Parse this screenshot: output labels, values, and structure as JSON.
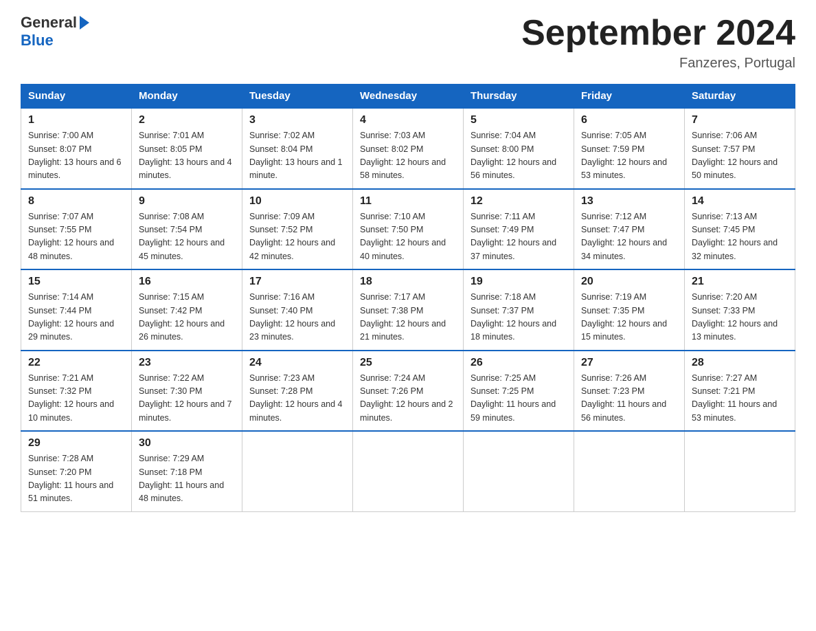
{
  "logo": {
    "general": "General",
    "blue": "Blue"
  },
  "title": "September 2024",
  "subtitle": "Fanzeres, Portugal",
  "days_of_week": [
    "Sunday",
    "Monday",
    "Tuesday",
    "Wednesday",
    "Thursday",
    "Friday",
    "Saturday"
  ],
  "weeks": [
    [
      {
        "day": "1",
        "sunrise": "7:00 AM",
        "sunset": "8:07 PM",
        "daylight": "13 hours and 6 minutes."
      },
      {
        "day": "2",
        "sunrise": "7:01 AM",
        "sunset": "8:05 PM",
        "daylight": "13 hours and 4 minutes."
      },
      {
        "day": "3",
        "sunrise": "7:02 AM",
        "sunset": "8:04 PM",
        "daylight": "13 hours and 1 minute."
      },
      {
        "day": "4",
        "sunrise": "7:03 AM",
        "sunset": "8:02 PM",
        "daylight": "12 hours and 58 minutes."
      },
      {
        "day": "5",
        "sunrise": "7:04 AM",
        "sunset": "8:00 PM",
        "daylight": "12 hours and 56 minutes."
      },
      {
        "day": "6",
        "sunrise": "7:05 AM",
        "sunset": "7:59 PM",
        "daylight": "12 hours and 53 minutes."
      },
      {
        "day": "7",
        "sunrise": "7:06 AM",
        "sunset": "7:57 PM",
        "daylight": "12 hours and 50 minutes."
      }
    ],
    [
      {
        "day": "8",
        "sunrise": "7:07 AM",
        "sunset": "7:55 PM",
        "daylight": "12 hours and 48 minutes."
      },
      {
        "day": "9",
        "sunrise": "7:08 AM",
        "sunset": "7:54 PM",
        "daylight": "12 hours and 45 minutes."
      },
      {
        "day": "10",
        "sunrise": "7:09 AM",
        "sunset": "7:52 PM",
        "daylight": "12 hours and 42 minutes."
      },
      {
        "day": "11",
        "sunrise": "7:10 AM",
        "sunset": "7:50 PM",
        "daylight": "12 hours and 40 minutes."
      },
      {
        "day": "12",
        "sunrise": "7:11 AM",
        "sunset": "7:49 PM",
        "daylight": "12 hours and 37 minutes."
      },
      {
        "day": "13",
        "sunrise": "7:12 AM",
        "sunset": "7:47 PM",
        "daylight": "12 hours and 34 minutes."
      },
      {
        "day": "14",
        "sunrise": "7:13 AM",
        "sunset": "7:45 PM",
        "daylight": "12 hours and 32 minutes."
      }
    ],
    [
      {
        "day": "15",
        "sunrise": "7:14 AM",
        "sunset": "7:44 PM",
        "daylight": "12 hours and 29 minutes."
      },
      {
        "day": "16",
        "sunrise": "7:15 AM",
        "sunset": "7:42 PM",
        "daylight": "12 hours and 26 minutes."
      },
      {
        "day": "17",
        "sunrise": "7:16 AM",
        "sunset": "7:40 PM",
        "daylight": "12 hours and 23 minutes."
      },
      {
        "day": "18",
        "sunrise": "7:17 AM",
        "sunset": "7:38 PM",
        "daylight": "12 hours and 21 minutes."
      },
      {
        "day": "19",
        "sunrise": "7:18 AM",
        "sunset": "7:37 PM",
        "daylight": "12 hours and 18 minutes."
      },
      {
        "day": "20",
        "sunrise": "7:19 AM",
        "sunset": "7:35 PM",
        "daylight": "12 hours and 15 minutes."
      },
      {
        "day": "21",
        "sunrise": "7:20 AM",
        "sunset": "7:33 PM",
        "daylight": "12 hours and 13 minutes."
      }
    ],
    [
      {
        "day": "22",
        "sunrise": "7:21 AM",
        "sunset": "7:32 PM",
        "daylight": "12 hours and 10 minutes."
      },
      {
        "day": "23",
        "sunrise": "7:22 AM",
        "sunset": "7:30 PM",
        "daylight": "12 hours and 7 minutes."
      },
      {
        "day": "24",
        "sunrise": "7:23 AM",
        "sunset": "7:28 PM",
        "daylight": "12 hours and 4 minutes."
      },
      {
        "day": "25",
        "sunrise": "7:24 AM",
        "sunset": "7:26 PM",
        "daylight": "12 hours and 2 minutes."
      },
      {
        "day": "26",
        "sunrise": "7:25 AM",
        "sunset": "7:25 PM",
        "daylight": "11 hours and 59 minutes."
      },
      {
        "day": "27",
        "sunrise": "7:26 AM",
        "sunset": "7:23 PM",
        "daylight": "11 hours and 56 minutes."
      },
      {
        "day": "28",
        "sunrise": "7:27 AM",
        "sunset": "7:21 PM",
        "daylight": "11 hours and 53 minutes."
      }
    ],
    [
      {
        "day": "29",
        "sunrise": "7:28 AM",
        "sunset": "7:20 PM",
        "daylight": "11 hours and 51 minutes."
      },
      {
        "day": "30",
        "sunrise": "7:29 AM",
        "sunset": "7:18 PM",
        "daylight": "11 hours and 48 minutes."
      },
      null,
      null,
      null,
      null,
      null
    ]
  ]
}
